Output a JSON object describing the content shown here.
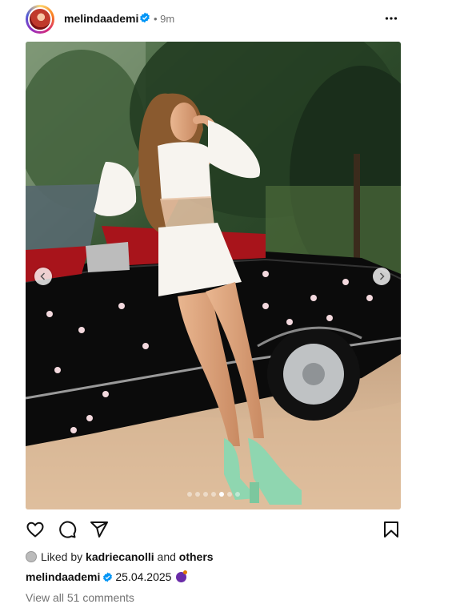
{
  "post": {
    "username": "melindaademi",
    "time_ago": "• 9m",
    "verified_icon": "verified-badge-icon",
    "more_icon": "more-horizontal-icon"
  },
  "carousel": {
    "total_slides": 7,
    "active_slide": 5,
    "prev_icon": "chevron-left-icon",
    "next_icon": "chevron-right-icon"
  },
  "actions": {
    "like_icon": "heart-icon",
    "comment_icon": "comment-icon",
    "share_icon": "send-icon",
    "save_icon": "bookmark-icon"
  },
  "likes": {
    "prefix": "Liked by",
    "user": "kadriecanolli",
    "conjunction": "and",
    "others": "others"
  },
  "caption": {
    "username": "melindaademi",
    "text": "25.04.2025"
  },
  "comments": {
    "view_all": "View all 51 comments"
  },
  "colors": {
    "verified": "#0095f6",
    "muted_text": "#737373",
    "shoe_green": "#8fd6b0"
  }
}
